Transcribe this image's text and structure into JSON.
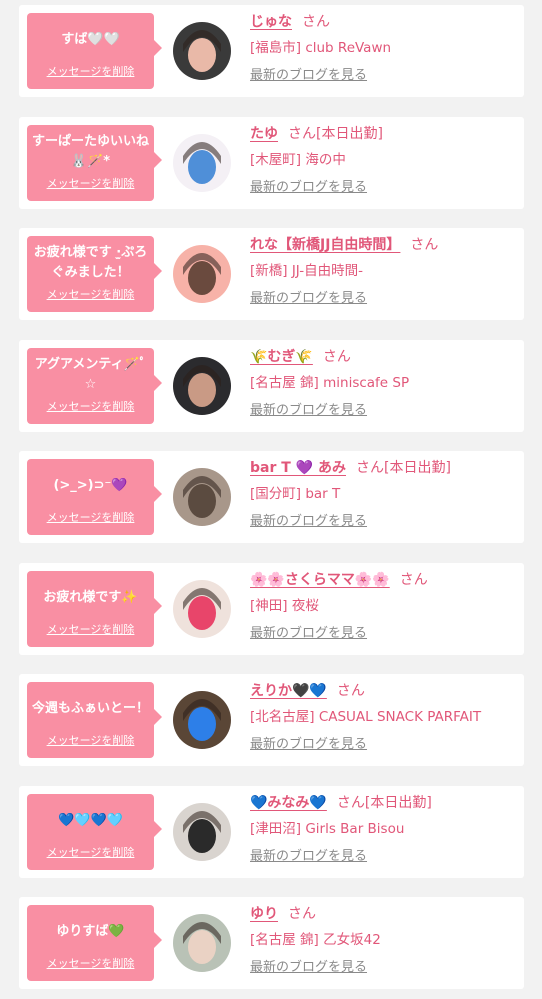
{
  "cards": [
    {
      "message": "すば🤍🤍",
      "delete_label": "メッセージを削除",
      "name": "じゅな",
      "san": "さん",
      "tag": "",
      "shop": "[福島市] club ReVawn",
      "blog_label": "最新のブログを見る",
      "avatar_color": "#3a3a3a",
      "avatar_face": "#e9b9a8"
    },
    {
      "message": "すーぱーたゆいいね🐰🪄*",
      "delete_label": "メッセージを削除",
      "name": "たゆ",
      "san": "さん",
      "tag": "[本日出勤]",
      "shop": "[木屋町] 海の中",
      "blog_label": "最新のブログを見る",
      "avatar_color": "#f4f0f5",
      "avatar_face": "#4f8fd8"
    },
    {
      "message": "お疲れ様です‪‪ ·̫ぷろぐみました！",
      "delete_label": "メッセージを削除",
      "name": "れな【新橋JJ自由時間】",
      "san": "さん",
      "tag": "",
      "shop": "[新橋] JJ-自由時間-",
      "blog_label": "最新のブログを見る",
      "avatar_color": "#f7b2a8",
      "avatar_face": "#6a4a3e"
    },
    {
      "message": "アグアメンティ🪄ﾟ☆",
      "delete_label": "メッセージを削除",
      "name": "🌾むぎ🌾",
      "san": "さん",
      "tag": "",
      "shop": "[名古屋 錦] miniscafe SP",
      "blog_label": "最新のブログを見る",
      "avatar_color": "#2b2b2e",
      "avatar_face": "#c99a85"
    },
    {
      "message": "(>_>)⊃⁻💜",
      "delete_label": "メッセージを削除",
      "name": "bar T 💜 あみ",
      "san": "さん",
      "tag": "[本日出勤]",
      "shop": "[国分町] bar T",
      "blog_label": "最新のブログを見る",
      "avatar_color": "#a8978a",
      "avatar_face": "#5b4b40"
    },
    {
      "message": "お疲れ様です✨",
      "delete_label": "メッセージを削除",
      "name": "🌸🌸さくらママ🌸🌸",
      "san": "さん",
      "tag": "",
      "shop": "[神田] 夜桜",
      "blog_label": "最新のブログを見る",
      "avatar_color": "#efe2dc",
      "avatar_face": "#e8456a"
    },
    {
      "message": "今週もふぁいとー！",
      "delete_label": "メッセージを削除",
      "name": "えりか🖤💙",
      "san": "さん",
      "tag": "",
      "shop": "[北名古屋] CASUAL SNACK PARFAIT",
      "blog_label": "最新のブログを見る",
      "avatar_color": "#5a4636",
      "avatar_face": "#2d7fe8"
    },
    {
      "message": "💙🩵💙🩵",
      "delete_label": "メッセージを削除",
      "name": "💙みなみ💙",
      "san": "さん",
      "tag": "[本日出勤]",
      "shop": "[津田沼] Girls Bar Bisou",
      "blog_label": "最新のブログを見る",
      "avatar_color": "#d9d4cf",
      "avatar_face": "#2a2a2a"
    },
    {
      "message": "ゆりすば💚",
      "delete_label": "メッセージを削除",
      "name": "ゆり",
      "san": "さん",
      "tag": "",
      "shop": "[名古屋 錦] 乙女坂42",
      "blog_label": "最新のブログを見る",
      "avatar_color": "#b9c2b6",
      "avatar_face": "#ead2c4"
    }
  ]
}
